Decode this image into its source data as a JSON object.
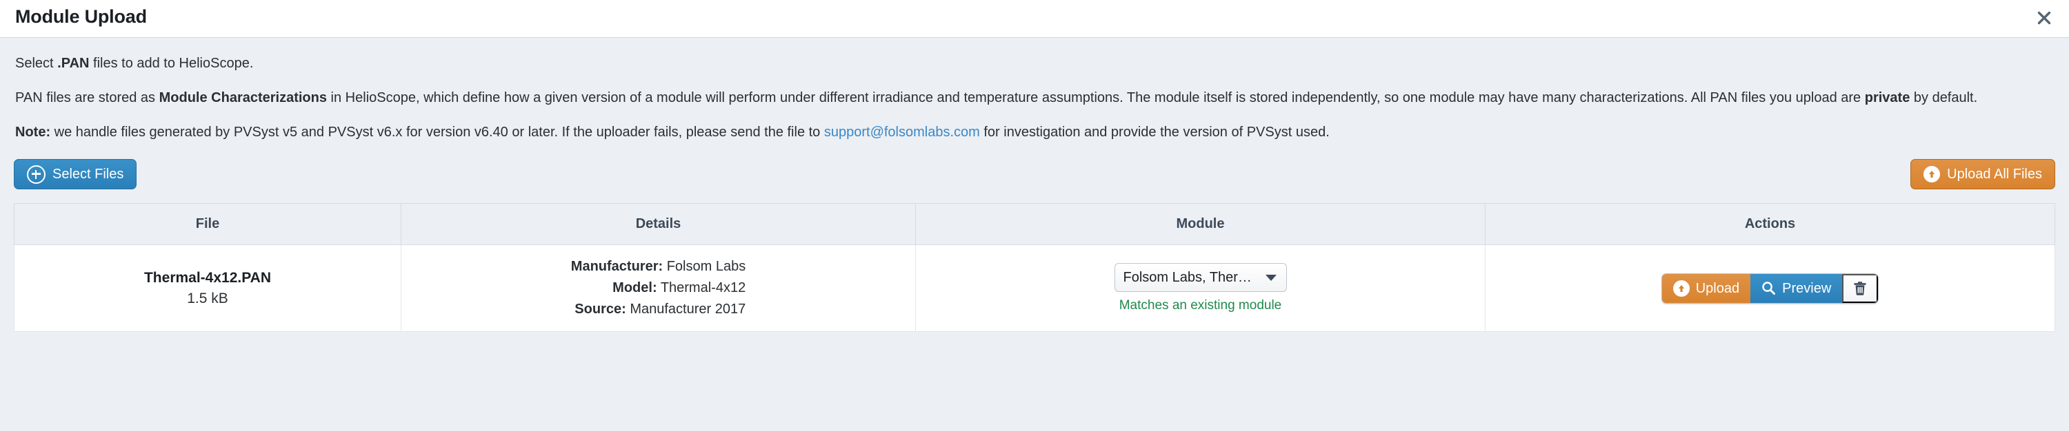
{
  "header": {
    "title": "Module Upload",
    "close_icon": "close-icon"
  },
  "intro": {
    "line1_pre": "Select ",
    "line1_bold": ".PAN",
    "line1_post": " files to add to HelioScope.",
    "para_pre": "PAN files are stored as ",
    "para_bold1": "Module Characterizations",
    "para_mid": " in HelioScope, which define how a given version of a module will perform under different irradiance and temperature assumptions. The module itself is stored independently, so one module may have many characterizations. All PAN files you upload are ",
    "para_bold2": "private",
    "para_post": " by default.",
    "note_label": "Note:",
    "note_pre": " we handle files generated by PVSyst v5 and PVSyst v6.x for version v6.40 or later. If the uploader fails, please send the file to ",
    "note_link": "support@folsomlabs.com",
    "note_post": " for investigation and provide the version of PVSyst used."
  },
  "toolbar": {
    "select_files_label": "Select Files",
    "select_files_icon": "plus-circle-icon",
    "upload_all_label": "Upload All Files",
    "upload_all_icon": "upload-circle-icon"
  },
  "table": {
    "columns": [
      "File",
      "Details",
      "Module",
      "Actions"
    ],
    "rows": [
      {
        "file_name": "Thermal-4x12.PAN",
        "file_size": "1.5 kB",
        "details": [
          {
            "label": "Manufacturer:",
            "value": "Folsom Labs"
          },
          {
            "label": "Model:",
            "value": "Thermal-4x12"
          },
          {
            "label": "Source:",
            "value": "Manufacturer 2017"
          }
        ],
        "module_select_value": "Folsom Labs, Thermal-...",
        "module_match_note": "Matches an existing module",
        "actions": {
          "upload_label": "Upload",
          "upload_icon": "upload-circle-icon",
          "preview_label": "Preview",
          "preview_icon": "search-icon",
          "delete_icon": "trash-icon"
        }
      }
    ]
  },
  "colors": {
    "accent_blue": "#2a7fb8",
    "accent_orange": "#d9832e",
    "success_green": "#1f8a4c",
    "body_bg": "#eceff3",
    "link_blue": "#3a87c8"
  }
}
